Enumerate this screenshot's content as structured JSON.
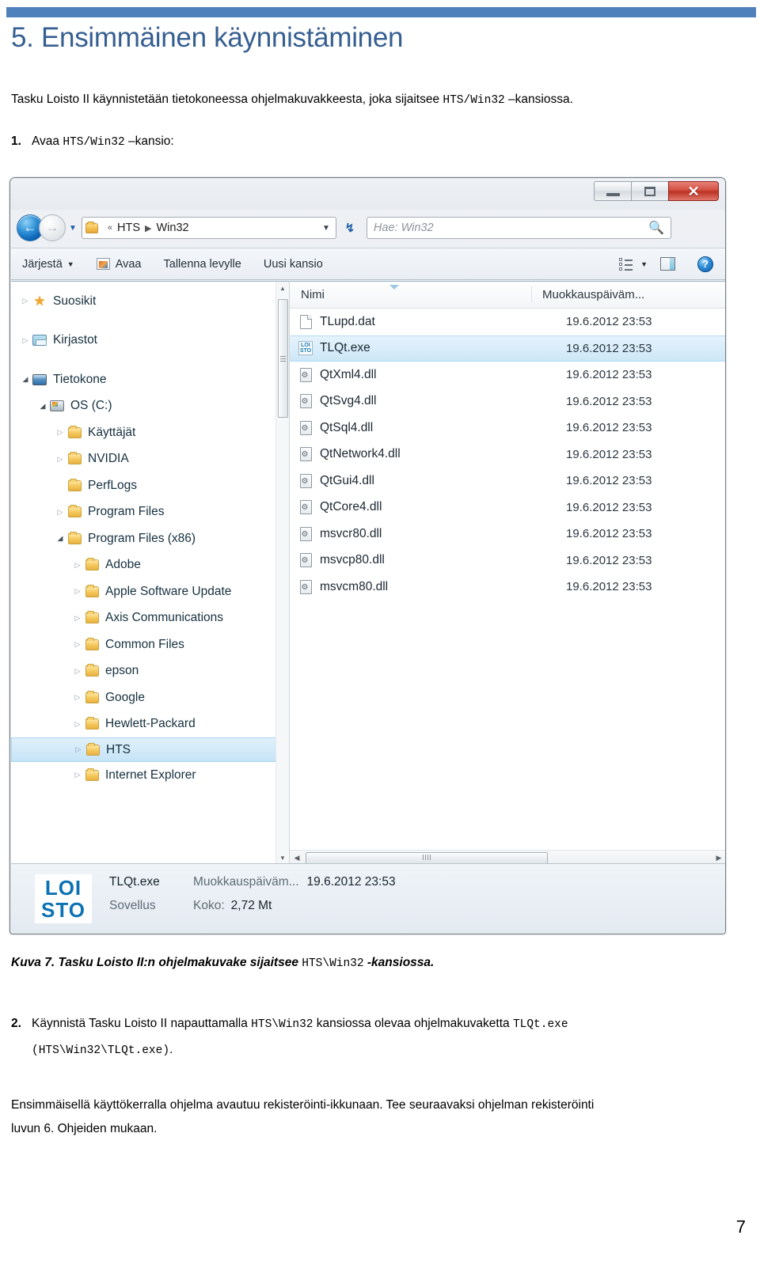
{
  "document": {
    "heading": "5. Ensimmäinen käynnistäminen",
    "intro_before": "Tasku Loisto II käynnistetään tietokoneessa ohjelmakuvakkeesta, joka sijaitsee ",
    "intro_mono": "HTS/Win32",
    "intro_after": " –kansiossa.",
    "step1_num": "1.",
    "step1_before": "Avaa ",
    "step1_mono": "HTS/Win32",
    "step1_after": " –kansio:",
    "caption_label": "Kuva 7.",
    "caption_text_before": " Tasku Loisto II:n ohjelmakuvake sijaitsee ",
    "caption_mono": "HTS\\Win32",
    "caption_text_after": " -kansiossa.",
    "step2_num": "2.",
    "step2_a": "Käynnistä Tasku Loisto II napauttamalla ",
    "step2_mono1": "HTS\\Win32",
    "step2_b": " kansiossa olevaa ohjelmakuvaketta ",
    "step2_mono2": "TLQt.exe",
    "step2_mono3": "(HTS\\Win32\\TLQt.exe)",
    "step2_c": ".",
    "closing_line1": "Ensimmäisellä käyttökerralla ohjelma avautuu rekisteröinti-ikkunaan. Tee seuraavaksi ohjelman rekisteröinti",
    "closing_line2": "luvun 6. Ohjeiden mukaan.",
    "page_number": "7",
    "accent_color": "#4F81BD",
    "heading_color": "#365F91"
  },
  "explorer": {
    "titlebar": {
      "minimize_label": "–",
      "maximize_label": "",
      "close_label": "✕"
    },
    "address": {
      "back_glyph": "←",
      "forward_glyph": "→",
      "recent_caret": "▼",
      "folder_icon": "folder-icon",
      "chevrons": "«",
      "crumb1": "HTS",
      "crumb_sep": "▶",
      "crumb2": "Win32",
      "dropdown_caret": "▼",
      "refresh_glyph": "↯",
      "search_placeholder": "Hae: Win32",
      "search_icon": "🔍"
    },
    "toolbar": {
      "organize": "Järjestä",
      "organize_caret": "▼",
      "open": "Avaa",
      "burn": "Tallenna levylle",
      "new_folder": "Uusi kansio",
      "views_caret": "▼"
    },
    "tree": [
      {
        "label": "Suosikit",
        "indent": 0,
        "icon": "star-icon",
        "twisty": "collapsed",
        "selected": false
      },
      {
        "label": "",
        "indent": 0,
        "icon": "spacer",
        "twisty": "none",
        "selected": false
      },
      {
        "label": "Kirjastot",
        "indent": 0,
        "icon": "library-icon",
        "twisty": "collapsed",
        "selected": false
      },
      {
        "label": "",
        "indent": 0,
        "icon": "spacer",
        "twisty": "none",
        "selected": false
      },
      {
        "label": "Tietokone",
        "indent": 0,
        "icon": "computer-icon",
        "twisty": "expanded",
        "selected": false
      },
      {
        "label": "OS (C:)",
        "indent": 1,
        "icon": "drive-icon",
        "twisty": "expanded",
        "selected": false
      },
      {
        "label": "Käyttäjät",
        "indent": 2,
        "icon": "folder-icon",
        "twisty": "collapsed",
        "selected": false
      },
      {
        "label": "NVIDIA",
        "indent": 2,
        "icon": "folder-icon",
        "twisty": "collapsed",
        "selected": false
      },
      {
        "label": "PerfLogs",
        "indent": 2,
        "icon": "folder-icon",
        "twisty": "none",
        "selected": false
      },
      {
        "label": "Program Files",
        "indent": 2,
        "icon": "folder-icon",
        "twisty": "collapsed",
        "selected": false
      },
      {
        "label": "Program Files (x86)",
        "indent": 2,
        "icon": "folder-icon",
        "twisty": "expanded",
        "selected": false
      },
      {
        "label": "Adobe",
        "indent": 3,
        "icon": "folder-icon",
        "twisty": "collapsed",
        "selected": false
      },
      {
        "label": "Apple Software Update",
        "indent": 3,
        "icon": "folder-icon",
        "twisty": "collapsed",
        "selected": false
      },
      {
        "label": "Axis Communications",
        "indent": 3,
        "icon": "folder-icon",
        "twisty": "collapsed",
        "selected": false
      },
      {
        "label": "Common Files",
        "indent": 3,
        "icon": "folder-icon",
        "twisty": "collapsed",
        "selected": false
      },
      {
        "label": "epson",
        "indent": 3,
        "icon": "folder-icon",
        "twisty": "collapsed",
        "selected": false
      },
      {
        "label": "Google",
        "indent": 3,
        "icon": "folder-icon",
        "twisty": "collapsed",
        "selected": false
      },
      {
        "label": "Hewlett-Packard",
        "indent": 3,
        "icon": "folder-icon",
        "twisty": "collapsed",
        "selected": false
      },
      {
        "label": "HTS",
        "indent": 3,
        "icon": "folder-icon",
        "twisty": "collapsed",
        "selected": true
      },
      {
        "label": "Internet Explorer",
        "indent": 3,
        "icon": "folder-icon",
        "twisty": "collapsed",
        "selected": false
      }
    ],
    "columns": {
      "name": "Nimi",
      "modified": "Muokkauspäiväm..."
    },
    "files": [
      {
        "name": "TLupd.dat",
        "modified": "19.6.2012 23:53",
        "icon": "document-icon",
        "selected": false
      },
      {
        "name": "TLQt.exe",
        "modified": "19.6.2012 23:53",
        "icon": "loisto-icon",
        "selected": true
      },
      {
        "name": "QtXml4.dll",
        "modified": "19.6.2012 23:53",
        "icon": "dll-icon",
        "selected": false
      },
      {
        "name": "QtSvg4.dll",
        "modified": "19.6.2012 23:53",
        "icon": "dll-icon",
        "selected": false
      },
      {
        "name": "QtSql4.dll",
        "modified": "19.6.2012 23:53",
        "icon": "dll-icon",
        "selected": false
      },
      {
        "name": "QtNetwork4.dll",
        "modified": "19.6.2012 23:53",
        "icon": "dll-icon",
        "selected": false
      },
      {
        "name": "QtGui4.dll",
        "modified": "19.6.2012 23:53",
        "icon": "dll-icon",
        "selected": false
      },
      {
        "name": "QtCore4.dll",
        "modified": "19.6.2012 23:53",
        "icon": "dll-icon",
        "selected": false
      },
      {
        "name": "msvcr80.dll",
        "modified": "19.6.2012 23:53",
        "icon": "dll-icon",
        "selected": false
      },
      {
        "name": "msvcp80.dll",
        "modified": "19.6.2012 23:53",
        "icon": "dll-icon",
        "selected": false
      },
      {
        "name": "msvcm80.dll",
        "modified": "19.6.2012 23:53",
        "icon": "dll-icon",
        "selected": false
      }
    ],
    "details": {
      "logo_line1": "LOI",
      "logo_line2": "STO",
      "file_name": "TLQt.exe",
      "modified_label": "Muokkauspäiväm...",
      "modified_value": "19.6.2012 23:53",
      "type_label": "Sovellus",
      "size_label": "Koko:",
      "size_value": "2,72 Mt"
    }
  }
}
